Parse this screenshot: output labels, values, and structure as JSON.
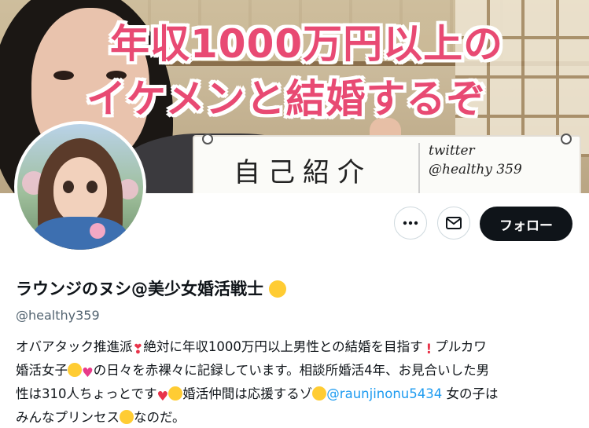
{
  "banner": {
    "caption_line1": "年収1000万円以上の",
    "caption_line2": "イケメンと結婚するぞ",
    "board_title": "自己紹介",
    "board_note_line1": "twitter",
    "board_note_line2": "@healthy 359"
  },
  "actions": {
    "more_icon": "more-horizontal-icon",
    "message_icon": "envelope-icon",
    "follow_label": "フォロー"
  },
  "profile": {
    "display_name": "ラウンジのヌシ@美少女婚活戦士",
    "handle": "@healthy359",
    "bio": {
      "line1_a": "オバアタック推進派",
      "line1_b": "絶対に年収1000万円以上男性との結婚を目指す",
      "line1_c": "プルカワ",
      "line2_a": "婚活女子",
      "line2_b": "の日々を赤裸々に記録しています。相談所婚活4年、お見合いした男",
      "line3_a": "性は310人ちょっとです",
      "line3_b": "婚活仲間は応援するゾ",
      "mention": "@raunjinonu5434",
      "line3_c": " 女の子は",
      "line4_a": "みんなプリンセス",
      "line4_b": "なのだ。"
    }
  },
  "colors": {
    "caption": "#e84a73",
    "follow_bg": "#0f1419",
    "mention": "#1d9bf0",
    "handle": "#536471"
  }
}
